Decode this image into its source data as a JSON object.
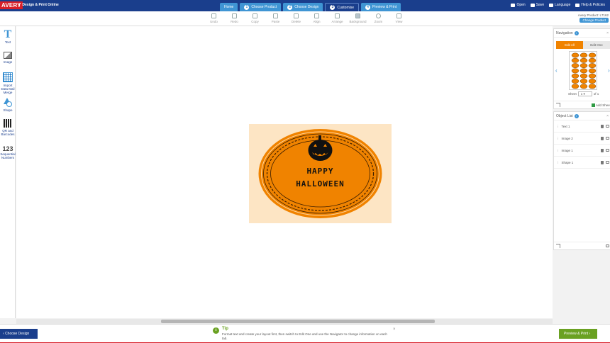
{
  "header": {
    "logo": "AVERY",
    "app_title": "Design & Print Online",
    "steps": [
      {
        "label": "Home",
        "num": ""
      },
      {
        "label": "Choose Product",
        "num": "1"
      },
      {
        "label": "Choose Design",
        "num": "2"
      },
      {
        "label": "Customise",
        "num": "3"
      },
      {
        "label": "Preview & Print",
        "num": "4"
      }
    ],
    "links": [
      {
        "label": "Open",
        "icon": "open-icon"
      },
      {
        "label": "Save",
        "icon": "save-icon"
      },
      {
        "label": "Language",
        "icon": "flag-icon"
      },
      {
        "label": "Help & Policies",
        "icon": "help-icon"
      }
    ]
  },
  "toolbar": {
    "tools": [
      {
        "label": "Undo",
        "icon": "undo-icon"
      },
      {
        "label": "Redo",
        "icon": "redo-icon"
      },
      {
        "label": "Copy",
        "icon": "copy-icon"
      },
      {
        "label": "Paste",
        "icon": "paste-icon"
      },
      {
        "label": "Delete",
        "icon": "delete-icon"
      },
      {
        "label": "Align",
        "icon": "align-icon"
      },
      {
        "label": "Arrange",
        "icon": "arrange-icon"
      },
      {
        "label": "Background",
        "icon": "background-icon"
      },
      {
        "label": "Zoom",
        "icon": "zoom-icon"
      },
      {
        "label": "View",
        "icon": "view-grid-icon"
      }
    ],
    "product_label": "Avery Product: L7162",
    "change_product": "Change Product"
  },
  "sidebar": {
    "items": [
      {
        "label": "Text",
        "icon": "text-icon"
      },
      {
        "label": "Image",
        "icon": "image-icon"
      },
      {
        "label": "Import Data Mail Merge",
        "icon": "table-icon"
      },
      {
        "label": "Shape",
        "icon": "shape-icon"
      },
      {
        "label": "QR and Barcodes",
        "icon": "qr-code-icon"
      },
      {
        "label": "Sequential Numbers",
        "icon": "numbers-icon"
      }
    ]
  },
  "canvas": {
    "label_text_line1": "HAPPY",
    "label_text_line2": "HALLOWEEN",
    "colors": {
      "card_bg": "#fde5c4",
      "oval": "#f08300",
      "pumpkin": "#111111"
    }
  },
  "navigation": {
    "title": "Navigation",
    "info": "i",
    "tabs": {
      "edit_all": "Edit All",
      "edit_one": "Edit One"
    },
    "sheet_label": "Sheet",
    "sheet_value": "1",
    "sheet_of": "of 1",
    "add_sheet": "Add Sheet",
    "close": "×"
  },
  "object_list": {
    "title": "Object List",
    "info": "i",
    "close": "×",
    "items": [
      "Text 1",
      "Image 2",
      "Image 1",
      "Shape 1"
    ]
  },
  "bottom": {
    "back_button": "Choose Design",
    "next_button": "Preview & Print",
    "tip_title": "Tip",
    "tip_text": "Format text and create your layout first, then switch to Edit One and use the Navigator to change information on each tab.",
    "tip_close": "×"
  },
  "colors": {
    "brand_blue": "#1a3e8c",
    "accent_blue": "#3f95d4",
    "orange": "#f08300",
    "green": "#6aa122",
    "red": "#d71e28"
  }
}
